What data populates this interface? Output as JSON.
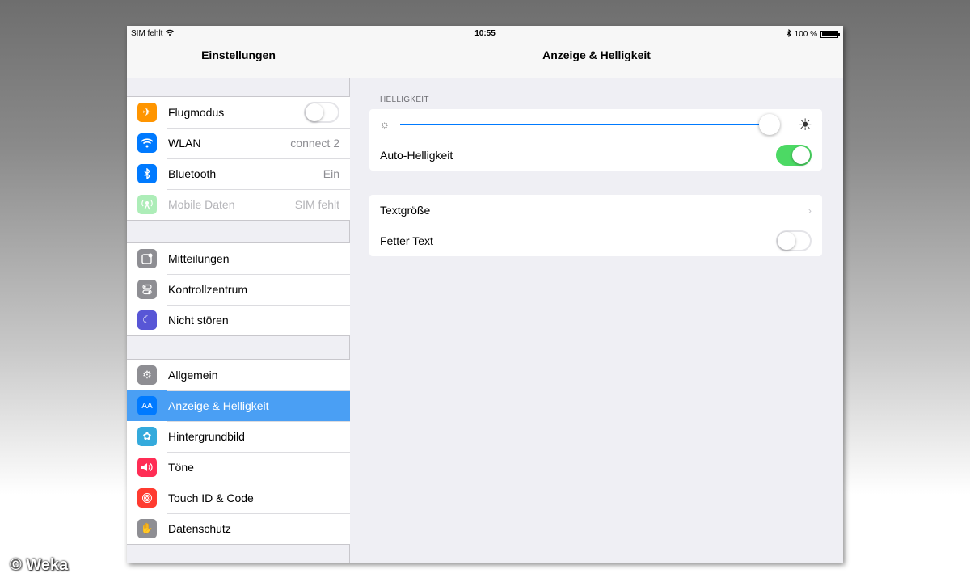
{
  "status": {
    "carrier": "SIM fehlt",
    "time": "10:55",
    "battery": "100 %",
    "battery_level": 1.0
  },
  "master": {
    "title": "Einstellungen",
    "groups": [
      [
        {
          "label": "Flugmodus",
          "icon": "airplane-icon",
          "color": "#ff9500",
          "toggle": false
        },
        {
          "label": "WLAN",
          "icon": "wifi-icon",
          "color": "#007aff",
          "value": "connect 2"
        },
        {
          "label": "Bluetooth",
          "icon": "bluetooth-icon",
          "color": "#007aff",
          "value": "Ein"
        },
        {
          "label": "Mobile Daten",
          "icon": "cellular-icon",
          "color": "#4cd964",
          "value": "SIM fehlt",
          "disabled": true
        }
      ],
      [
        {
          "label": "Mitteilungen",
          "icon": "notifications-icon",
          "color": "#8e8e93"
        },
        {
          "label": "Kontrollzentrum",
          "icon": "control-center-icon",
          "color": "#8e8e93"
        },
        {
          "label": "Nicht stören",
          "icon": "moon-icon",
          "color": "#5856d6"
        }
      ],
      [
        {
          "label": "Allgemein",
          "icon": "gear-icon",
          "color": "#8e8e93"
        },
        {
          "label": "Anzeige & Helligkeit",
          "icon": "text-size-icon",
          "color": "#007aff",
          "selected": true
        },
        {
          "label": "Hintergrundbild",
          "icon": "wallpaper-icon",
          "color": "#34aadc"
        },
        {
          "label": "Töne",
          "icon": "speaker-icon",
          "color": "#ff2d55"
        },
        {
          "label": "Touch ID & Code",
          "icon": "fingerprint-icon",
          "color": "#ff3b30"
        },
        {
          "label": "Datenschutz",
          "icon": "hand-icon",
          "color": "#8e8e93"
        }
      ]
    ]
  },
  "detail": {
    "title": "Anzeige & Helligkeit",
    "brightness_header": "HELLIGKEIT",
    "brightness_level": 0.98,
    "auto_brightness_label": "Auto-Helligkeit",
    "auto_brightness": true,
    "text_size_label": "Textgröße",
    "bold_text_label": "Fetter Text",
    "bold_text": false
  },
  "watermark": "© Weka",
  "colors": {
    "accent": "#007aff",
    "selected_row": "#4a9ff4",
    "toggle_on": "#4cd964"
  }
}
